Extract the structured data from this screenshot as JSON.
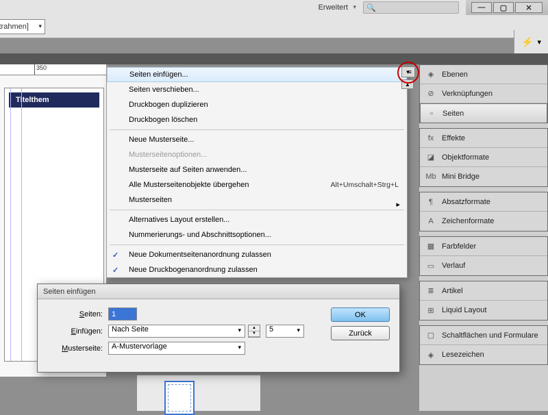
{
  "window": {
    "mode_label": "Erweitert",
    "search_placeholder": ""
  },
  "control_left": "xtrahmen]",
  "ruler": {
    "marks": [
      "350"
    ]
  },
  "doc": {
    "title": "Titelthem"
  },
  "context_menu": {
    "items": [
      {
        "label": "Seiten einfügen...",
        "hover": true
      },
      {
        "label": "Seiten verschieben..."
      },
      {
        "label": "Druckbogen duplizieren"
      },
      {
        "label": "Druckbogen löschen"
      },
      {
        "sep": true
      },
      {
        "label": "Neue Musterseite..."
      },
      {
        "label": "Musterseitenoptionen...",
        "disabled": true
      },
      {
        "label": "Musterseite auf Seiten anwenden..."
      },
      {
        "label": "Alle Musterseitenobjekte übergehen",
        "shortcut": "Alt+Umschalt+Strg+L"
      },
      {
        "label": "Musterseiten",
        "submenu": true
      },
      {
        "sep": true
      },
      {
        "label": "Alternatives Layout erstellen..."
      },
      {
        "label": "Nummerierungs- und Abschnittsoptionen..."
      },
      {
        "sep": true
      },
      {
        "label": "Neue Dokumentseitenanordnung zulassen",
        "checked": true
      },
      {
        "label": "Neue Druckbogenanordnung zulassen",
        "checked": true
      }
    ]
  },
  "panels": [
    [
      {
        "label": "Ebenen",
        "icon": "◈"
      },
      {
        "label": "Verknüpfungen",
        "icon": "⊘"
      },
      {
        "label": "Seiten",
        "icon": "▫",
        "active": true
      }
    ],
    [
      {
        "label": "Effekte",
        "icon": "fx"
      },
      {
        "label": "Objektformate",
        "icon": "◪"
      },
      {
        "label": "Mini Bridge",
        "icon": "Mb"
      }
    ],
    [
      {
        "label": "Absatzformate",
        "icon": "¶"
      },
      {
        "label": "Zeichenformate",
        "icon": "A"
      }
    ],
    [
      {
        "label": "Farbfelder",
        "icon": "▦"
      },
      {
        "label": "Verlauf",
        "icon": "▭"
      }
    ],
    [
      {
        "label": "Artikel",
        "icon": "≣"
      },
      {
        "label": "Liquid Layout",
        "icon": "⊞"
      }
    ],
    [
      {
        "label": "Schaltflächen und Formulare",
        "icon": "▢"
      },
      {
        "label": "Lesezeichen",
        "icon": "◈"
      }
    ]
  ],
  "dialog": {
    "title": "Seiten einfügen",
    "labels": {
      "pages": "Seiten:",
      "insert": "Einfügen:",
      "master": "Musterseite:"
    },
    "values": {
      "pages": "1",
      "insert_mode": "Nach Seite",
      "insert_at": "5",
      "master": "A-Mustervorlage"
    },
    "buttons": {
      "ok": "OK",
      "cancel": "Zurück"
    }
  }
}
